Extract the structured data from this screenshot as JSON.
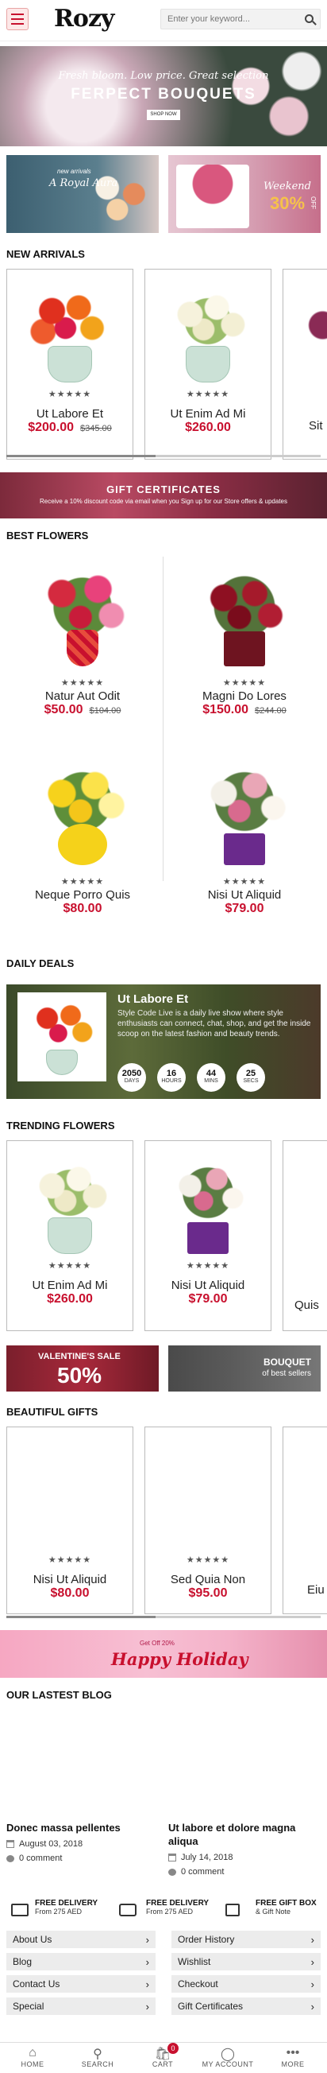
{
  "header": {
    "logo": "Rozy",
    "search_placeholder": "Enter your keyword..."
  },
  "hero": {
    "subtitle": "Fresh bloom. Low price. Great selection",
    "title": "FERPECT BOUQUETS",
    "button": "SHOP NOW"
  },
  "promos": {
    "left_small": "new arrivals",
    "left_big": "A Royal Aura",
    "right_word": "Weekend",
    "right_pct": "30%",
    "right_off": "OFF"
  },
  "new_arrivals": {
    "title": "NEW ARRIVALS",
    "items": [
      {
        "name": "Ut Labore Et",
        "price": "$200.00",
        "old_price": "$345.00",
        "rating": "★★★★★"
      },
      {
        "name": "Ut Enim Ad Mi",
        "price": "$260.00",
        "old_price": "",
        "rating": "★★★★★"
      },
      {
        "name": "Sit",
        "price": "",
        "old_price": "",
        "rating": ""
      }
    ]
  },
  "gift_cert": {
    "title": "GIFT CERTIFICATES",
    "text": "Receive a 10% discount code via email when you Sign up for our Store offers & updates"
  },
  "best_flowers": {
    "title": "BEST FLOWERS",
    "items": [
      {
        "name": "Natur Aut Odit",
        "price": "$50.00",
        "old_price": "$104.00",
        "rating": "★★★★★"
      },
      {
        "name": "Magni Do Lores",
        "price": "$150.00",
        "old_price": "$244.00",
        "rating": "★★★★★"
      },
      {
        "name": "Neque Porro Quis",
        "price": "$80.00",
        "old_price": "",
        "rating": "★★★★★"
      },
      {
        "name": "Nisi Ut Aliquid",
        "price": "$79.00",
        "old_price": "",
        "rating": "★★★★★"
      }
    ]
  },
  "daily_deals": {
    "title": "DAILY DEALS",
    "product": "Ut Labore Et",
    "desc": "Style Code Live is a daily live show where style enthusiasts can connect, chat, shop, and get the inside scoop on the latest fashion and beauty trends.",
    "countdown": [
      {
        "value": "2050",
        "unit": "DAYS"
      },
      {
        "value": "16",
        "unit": "HOURS"
      },
      {
        "value": "44",
        "unit": "MINS"
      },
      {
        "value": "25",
        "unit": "SECS"
      }
    ]
  },
  "trending": {
    "title": "TRENDING FLOWERS",
    "items": [
      {
        "name": "Ut Enim Ad Mi",
        "price": "$260.00",
        "rating": "★★★★★"
      },
      {
        "name": "Nisi Ut Aliquid",
        "price": "$79.00",
        "rating": "★★★★★"
      },
      {
        "name": "Quis",
        "price": "",
        "rating": ""
      }
    ]
  },
  "banners": {
    "vday_small": "VALENTINE'S SALE",
    "vday_big": "50%",
    "bouquet_title": "BOUQUET",
    "bouquet_sub": "of best sellers"
  },
  "beautiful_gifts": {
    "title": "BEAUTIFUL GIFTS",
    "items": [
      {
        "name": "Nisi Ut Aliquid",
        "price": "$80.00",
        "rating": "★★★★★"
      },
      {
        "name": "Sed Quia Non",
        "price": "$95.00",
        "rating": "★★★★★"
      },
      {
        "name": "Eiu",
        "price": "",
        "rating": ""
      }
    ]
  },
  "holiday": {
    "small": "Get Off 20%",
    "big": "Happy Holiday"
  },
  "blog": {
    "title": "OUR LASTEST BLOG",
    "posts": [
      {
        "title": "Donec massa pellentes",
        "date": "August 03, 2018",
        "comments": "0 comment"
      },
      {
        "title": "Ut labore et dolore magna aliqua",
        "date": "July 14, 2018",
        "comments": "0 comment"
      }
    ]
  },
  "features": [
    {
      "title": "FREE DELIVERY",
      "sub": "From 275 AED"
    },
    {
      "title": "FREE DELIVERY",
      "sub": "From 275 AED"
    },
    {
      "title": "FREE GIFT BOX",
      "sub": "& Gift Note"
    }
  ],
  "footer_links": {
    "left": [
      "About Us",
      "Blog",
      "Contact Us",
      "Special"
    ],
    "right": [
      "Order History",
      "Wishlist",
      "Checkout",
      "Gift Certificates"
    ]
  },
  "bottom_nav": {
    "items": [
      "HOME",
      "SEARCH",
      "CART",
      "MY ACCOUNT",
      "MORE"
    ],
    "cart_count": "0"
  },
  "colors": {
    "accent": "#c8102e"
  }
}
